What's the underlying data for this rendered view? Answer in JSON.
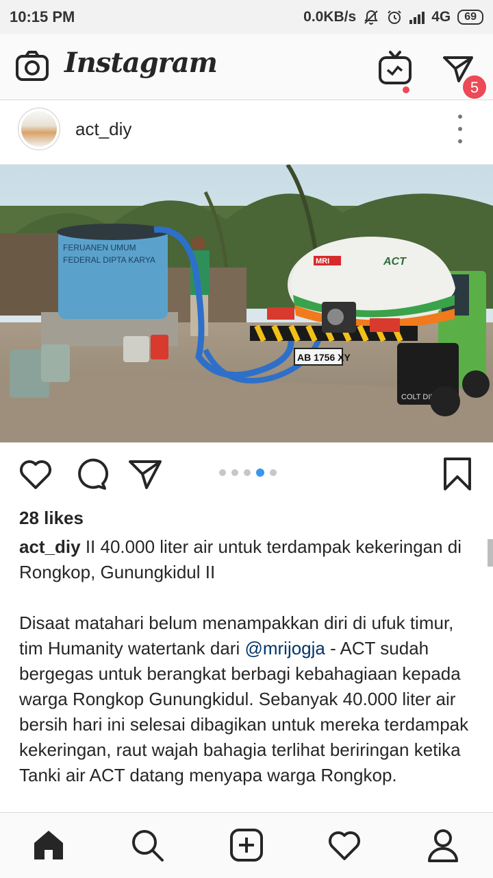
{
  "status_bar": {
    "time": "10:15 PM",
    "net_speed": "0.0KB/s",
    "network": "4G",
    "battery": "69"
  },
  "app": {
    "logo": "Instagram",
    "dm_badge": "5"
  },
  "post": {
    "username": "act_diy",
    "likes": "28 likes",
    "carousel": {
      "count": 5,
      "active_index": 3
    },
    "caption": {
      "author": "act_diy",
      "headline": " II 40.000 liter air untuk terdampak kekeringan di Rongkop, Gunungkidul II",
      "body_pre": "Disaat matahari belum menampakkan diri di ufuk timur, tim Humanity watertank dari ",
      "mention": "@mrijogja",
      "body_post": " - ACT sudah bergegas untuk berangkat berbagi kebahagiaan kepada warga Rongkop Gunungkidul. Sebanyak 40.000 liter air bersih hari ini selesai dibagikan untuk mereka terdampak kekeringan, raut wajah bahagia terlihat beriringan ketika Tanki air ACT datang menyapa warga Rongkop."
    },
    "image_text": {
      "tank_line1": "FERUANEN UMUM",
      "tank_line2": "FEDERAL DIPTA KARYA",
      "truck_brand": "ACT",
      "truck_logo": "MRI",
      "plate": "AB 1756 XY",
      "colt": "COLT DIESEL"
    }
  },
  "colors": {
    "accent_blue": "#3897f0",
    "badge_red": "#ed4956",
    "mention": "#003569"
  },
  "icons": [
    "camera-icon",
    "igtv-icon",
    "direct-message-icon",
    "more-options-icon",
    "heart-icon",
    "comment-icon",
    "share-icon",
    "bookmark-icon",
    "home-icon",
    "search-icon",
    "new-post-icon",
    "activity-heart-icon",
    "profile-icon"
  ]
}
